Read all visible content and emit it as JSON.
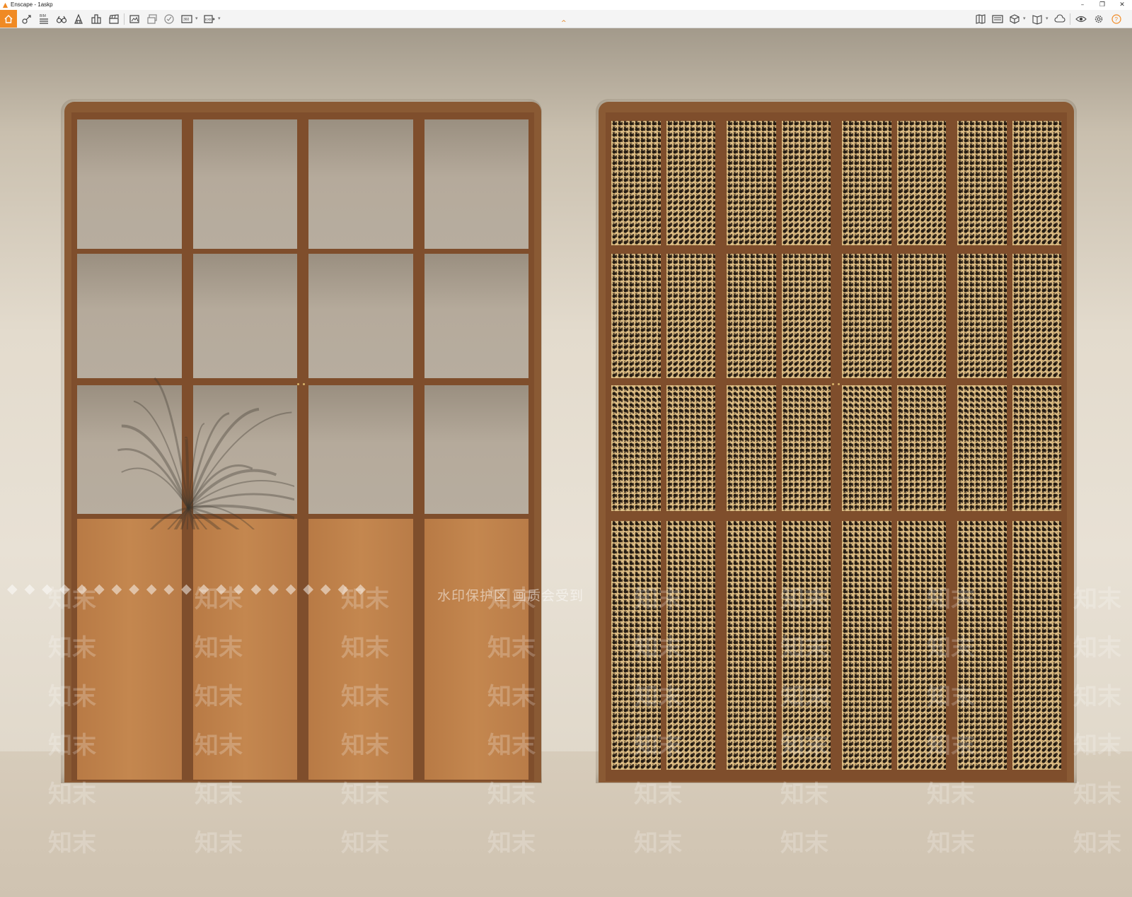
{
  "window": {
    "title": "Enscape - 1askp",
    "controls": [
      "–",
      "❐",
      "✕"
    ]
  },
  "toolbar": {
    "left_tools": [
      {
        "name": "home",
        "icon": "home-icon",
        "active": true
      },
      {
        "name": "asset-library",
        "icon": "asset-library-icon"
      },
      {
        "name": "bim",
        "icon": "bim-icon",
        "label": "BIM"
      },
      {
        "name": "binoculars",
        "icon": "binoculars-icon"
      },
      {
        "name": "site-context",
        "icon": "site-context-icon"
      },
      {
        "name": "buildings",
        "icon": "buildings-icon"
      },
      {
        "name": "clapper",
        "icon": "clapperboard-icon"
      },
      {
        "name": "screenshot",
        "icon": "screenshot-icon"
      },
      {
        "name": "batch-render",
        "icon": "batch-render-icon"
      },
      {
        "name": "vr",
        "icon": "vr-icon"
      },
      {
        "name": "panorama",
        "icon": "panorama-icon",
        "label": "360"
      },
      {
        "name": "export",
        "icon": "export-icon",
        "label": "EXE"
      }
    ],
    "right_tools": [
      {
        "name": "views",
        "icon": "views-icon"
      },
      {
        "name": "video-editor",
        "icon": "video-editor-icon"
      },
      {
        "name": "cube",
        "icon": "cube-icon"
      },
      {
        "name": "book",
        "icon": "book-icon"
      },
      {
        "name": "cloud",
        "icon": "cloud-icon"
      },
      {
        "name": "visibility",
        "icon": "eye-icon"
      },
      {
        "name": "settings",
        "icon": "gear-icon"
      },
      {
        "name": "help",
        "icon": "help-icon",
        "label": "?"
      }
    ],
    "collapse_caret": "^"
  },
  "viewport": {
    "watermark_text": "水印保护区  画质会受到",
    "watermark_diamonds": "◆◆◆◆◆◆◆◆◆◆◆◆◆◆◆◆◆◆◆◆◆",
    "watermark_tile": "知末",
    "colors": {
      "wall": "#e3dbcd",
      "frame": "#8a5a34",
      "wood": "#c4874f",
      "floor": "#d2c6b4"
    }
  }
}
